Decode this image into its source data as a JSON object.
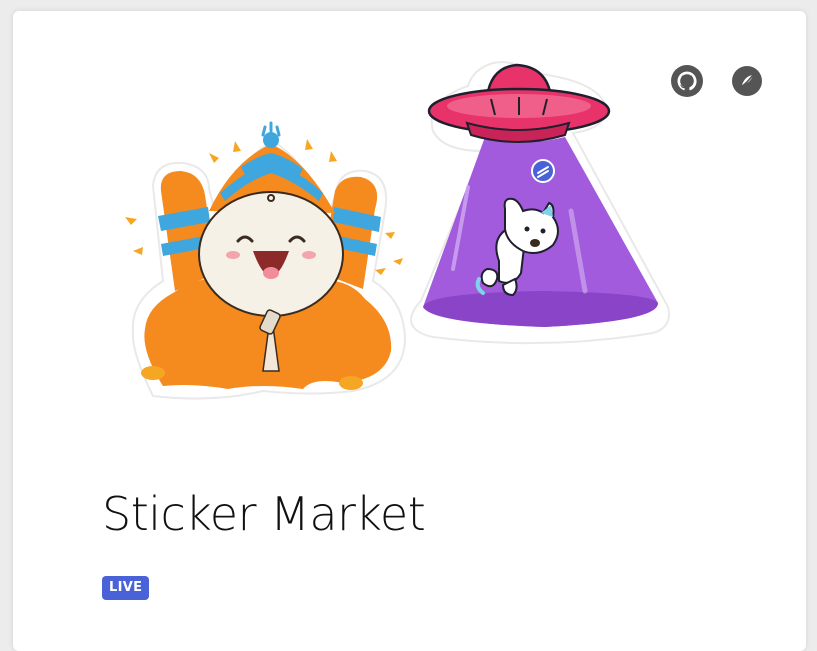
{
  "project": {
    "title": "Sticker Market",
    "status_badge": "LIVE"
  },
  "links": {
    "github_icon": "github-icon",
    "website_icon": "website-icon"
  },
  "colors": {
    "badge": "#4a62d8",
    "title": "#111111",
    "icon": "#555555"
  }
}
